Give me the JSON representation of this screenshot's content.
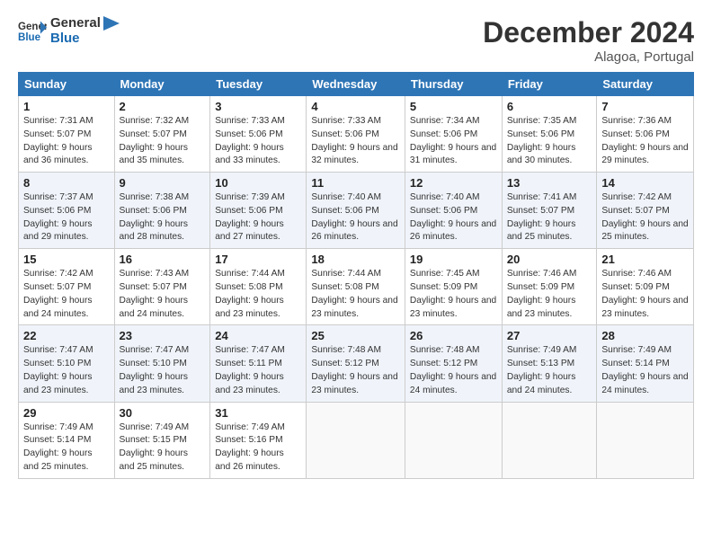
{
  "logo": {
    "line1": "General",
    "line2": "Blue"
  },
  "title": "December 2024",
  "location": "Alagoa, Portugal",
  "weekdays": [
    "Sunday",
    "Monday",
    "Tuesday",
    "Wednesday",
    "Thursday",
    "Friday",
    "Saturday"
  ],
  "weeks": [
    [
      {
        "day": "1",
        "sunrise": "7:31 AM",
        "sunset": "5:07 PM",
        "daylight": "9 hours and 36 minutes."
      },
      {
        "day": "2",
        "sunrise": "7:32 AM",
        "sunset": "5:07 PM",
        "daylight": "9 hours and 35 minutes."
      },
      {
        "day": "3",
        "sunrise": "7:33 AM",
        "sunset": "5:06 PM",
        "daylight": "9 hours and 33 minutes."
      },
      {
        "day": "4",
        "sunrise": "7:33 AM",
        "sunset": "5:06 PM",
        "daylight": "9 hours and 32 minutes."
      },
      {
        "day": "5",
        "sunrise": "7:34 AM",
        "sunset": "5:06 PM",
        "daylight": "9 hours and 31 minutes."
      },
      {
        "day": "6",
        "sunrise": "7:35 AM",
        "sunset": "5:06 PM",
        "daylight": "9 hours and 30 minutes."
      },
      {
        "day": "7",
        "sunrise": "7:36 AM",
        "sunset": "5:06 PM",
        "daylight": "9 hours and 29 minutes."
      }
    ],
    [
      {
        "day": "8",
        "sunrise": "7:37 AM",
        "sunset": "5:06 PM",
        "daylight": "9 hours and 29 minutes."
      },
      {
        "day": "9",
        "sunrise": "7:38 AM",
        "sunset": "5:06 PM",
        "daylight": "9 hours and 28 minutes."
      },
      {
        "day": "10",
        "sunrise": "7:39 AM",
        "sunset": "5:06 PM",
        "daylight": "9 hours and 27 minutes."
      },
      {
        "day": "11",
        "sunrise": "7:40 AM",
        "sunset": "5:06 PM",
        "daylight": "9 hours and 26 minutes."
      },
      {
        "day": "12",
        "sunrise": "7:40 AM",
        "sunset": "5:06 PM",
        "daylight": "9 hours and 26 minutes."
      },
      {
        "day": "13",
        "sunrise": "7:41 AM",
        "sunset": "5:07 PM",
        "daylight": "9 hours and 25 minutes."
      },
      {
        "day": "14",
        "sunrise": "7:42 AM",
        "sunset": "5:07 PM",
        "daylight": "9 hours and 25 minutes."
      }
    ],
    [
      {
        "day": "15",
        "sunrise": "7:42 AM",
        "sunset": "5:07 PM",
        "daylight": "9 hours and 24 minutes."
      },
      {
        "day": "16",
        "sunrise": "7:43 AM",
        "sunset": "5:07 PM",
        "daylight": "9 hours and 24 minutes."
      },
      {
        "day": "17",
        "sunrise": "7:44 AM",
        "sunset": "5:08 PM",
        "daylight": "9 hours and 23 minutes."
      },
      {
        "day": "18",
        "sunrise": "7:44 AM",
        "sunset": "5:08 PM",
        "daylight": "9 hours and 23 minutes."
      },
      {
        "day": "19",
        "sunrise": "7:45 AM",
        "sunset": "5:09 PM",
        "daylight": "9 hours and 23 minutes."
      },
      {
        "day": "20",
        "sunrise": "7:46 AM",
        "sunset": "5:09 PM",
        "daylight": "9 hours and 23 minutes."
      },
      {
        "day": "21",
        "sunrise": "7:46 AM",
        "sunset": "5:09 PM",
        "daylight": "9 hours and 23 minutes."
      }
    ],
    [
      {
        "day": "22",
        "sunrise": "7:47 AM",
        "sunset": "5:10 PM",
        "daylight": "9 hours and 23 minutes."
      },
      {
        "day": "23",
        "sunrise": "7:47 AM",
        "sunset": "5:10 PM",
        "daylight": "9 hours and 23 minutes."
      },
      {
        "day": "24",
        "sunrise": "7:47 AM",
        "sunset": "5:11 PM",
        "daylight": "9 hours and 23 minutes."
      },
      {
        "day": "25",
        "sunrise": "7:48 AM",
        "sunset": "5:12 PM",
        "daylight": "9 hours and 23 minutes."
      },
      {
        "day": "26",
        "sunrise": "7:48 AM",
        "sunset": "5:12 PM",
        "daylight": "9 hours and 24 minutes."
      },
      {
        "day": "27",
        "sunrise": "7:49 AM",
        "sunset": "5:13 PM",
        "daylight": "9 hours and 24 minutes."
      },
      {
        "day": "28",
        "sunrise": "7:49 AM",
        "sunset": "5:14 PM",
        "daylight": "9 hours and 24 minutes."
      }
    ],
    [
      {
        "day": "29",
        "sunrise": "7:49 AM",
        "sunset": "5:14 PM",
        "daylight": "9 hours and 25 minutes."
      },
      {
        "day": "30",
        "sunrise": "7:49 AM",
        "sunset": "5:15 PM",
        "daylight": "9 hours and 25 minutes."
      },
      {
        "day": "31",
        "sunrise": "7:49 AM",
        "sunset": "5:16 PM",
        "daylight": "9 hours and 26 minutes."
      },
      null,
      null,
      null,
      null
    ]
  ],
  "labels": {
    "sunrise": "Sunrise:",
    "sunset": "Sunset:",
    "daylight": "Daylight:"
  }
}
